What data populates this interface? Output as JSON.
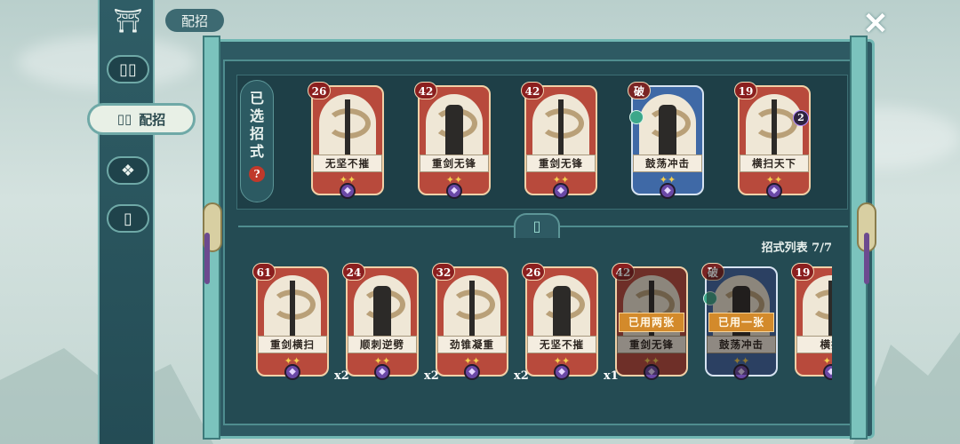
{
  "page_title": "配招",
  "nav": {
    "items": [
      {
        "name": "home",
        "icon": "temple-icon"
      },
      {
        "name": "cards",
        "icon": "cards-icon"
      },
      {
        "name": "deck",
        "icon": "deck-icon",
        "label": "配招",
        "active": true
      },
      {
        "name": "emblem",
        "icon": "emblem-icon"
      },
      {
        "name": "single-card",
        "icon": "card-icon"
      }
    ]
  },
  "selected": {
    "label_chars": [
      "已",
      "选",
      "招",
      "式"
    ],
    "help": "?"
  },
  "list_header": "招式列表 7/7",
  "selected_cards": [
    {
      "cost": "26",
      "name": "无坚不摧",
      "color": "red",
      "mark": ""
    },
    {
      "cost": "42",
      "name": "重剑无锋",
      "color": "red",
      "mark": ""
    },
    {
      "cost": "42",
      "name": "重剑无锋",
      "color": "red",
      "mark": ""
    },
    {
      "cost": "破",
      "name": "鼓荡冲击",
      "color": "blue",
      "mark": ""
    },
    {
      "cost": "19",
      "name": "横扫天下",
      "color": "red",
      "mark": "2"
    }
  ],
  "list_cards": [
    {
      "cost": "61",
      "name": "重剑横扫",
      "color": "red",
      "count": "x2",
      "used": ""
    },
    {
      "cost": "24",
      "name": "顺刺逆劈",
      "color": "red",
      "count": "x2",
      "used": ""
    },
    {
      "cost": "32",
      "name": "劲锥凝重",
      "color": "red",
      "count": "x2",
      "used": ""
    },
    {
      "cost": "26",
      "name": "无坚不摧",
      "color": "red",
      "count": "x1",
      "used": ""
    },
    {
      "cost": "42",
      "name": "重剑无锋",
      "color": "red",
      "count": "",
      "used": "已用两张"
    },
    {
      "cost": "破",
      "name": "鼓荡冲击",
      "color": "blue",
      "count": "",
      "used": "已用一张"
    },
    {
      "cost": "19",
      "name": "横扫",
      "color": "red",
      "count": "",
      "used": ""
    }
  ],
  "colors": {
    "red_card": "#b84a3c",
    "blue_card": "#3f69a6",
    "frame": "#2e5a63",
    "accent": "#72b8b4"
  }
}
